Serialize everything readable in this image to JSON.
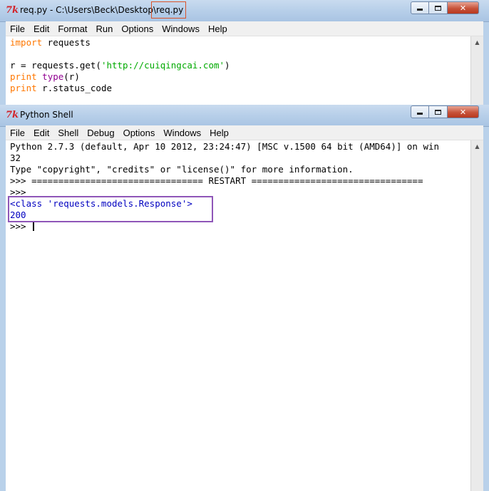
{
  "editor_window": {
    "title_prefix": "req.py - C:\\Users\\Beck\\Desktop\\",
    "title_file": "req.py",
    "menu": [
      "File",
      "Edit",
      "Format",
      "Run",
      "Options",
      "Windows",
      "Help"
    ],
    "code": {
      "line1_kw": "import",
      "line1_rest": " requests",
      "line3_pre": "r = requests.get(",
      "line3_str": "'http://cuiqingcai.com'",
      "line3_post": ")",
      "line4_kw": "print",
      "line4_sp": " ",
      "line4_bi": "type",
      "line4_post": "(r)",
      "line5_kw": "print",
      "line5_post": " r.status_code"
    }
  },
  "shell_window": {
    "title": "Python Shell",
    "menu": [
      "File",
      "Edit",
      "Shell",
      "Debug",
      "Options",
      "Windows",
      "Help"
    ],
    "lines": {
      "banner1": "Python 2.7.3 (default, Apr 10 2012, 23:24:47) [MSC v.1500 64 bit (AMD64)] on win",
      "banner2": "32",
      "banner3": "Type \"copyright\", \"credits\" or \"license()\" for more information.",
      "restart": ">>> ================================ RESTART ================================",
      "prompt1": ">>> ",
      "output1": "<class 'requests.models.Response'>",
      "output2": "200",
      "prompt2": ">>> "
    }
  },
  "icons": {
    "app_icon": "tk-feather-icon",
    "minimize": "minimize-icon",
    "maximize": "maximize-icon",
    "close": "close-icon"
  },
  "colors": {
    "keyword": "#ff7700",
    "builtin": "#900090",
    "string": "#00aa00",
    "stdout": "#0000c0",
    "highlight_red": "#d9542b",
    "highlight_purple": "#8f56b8"
  }
}
